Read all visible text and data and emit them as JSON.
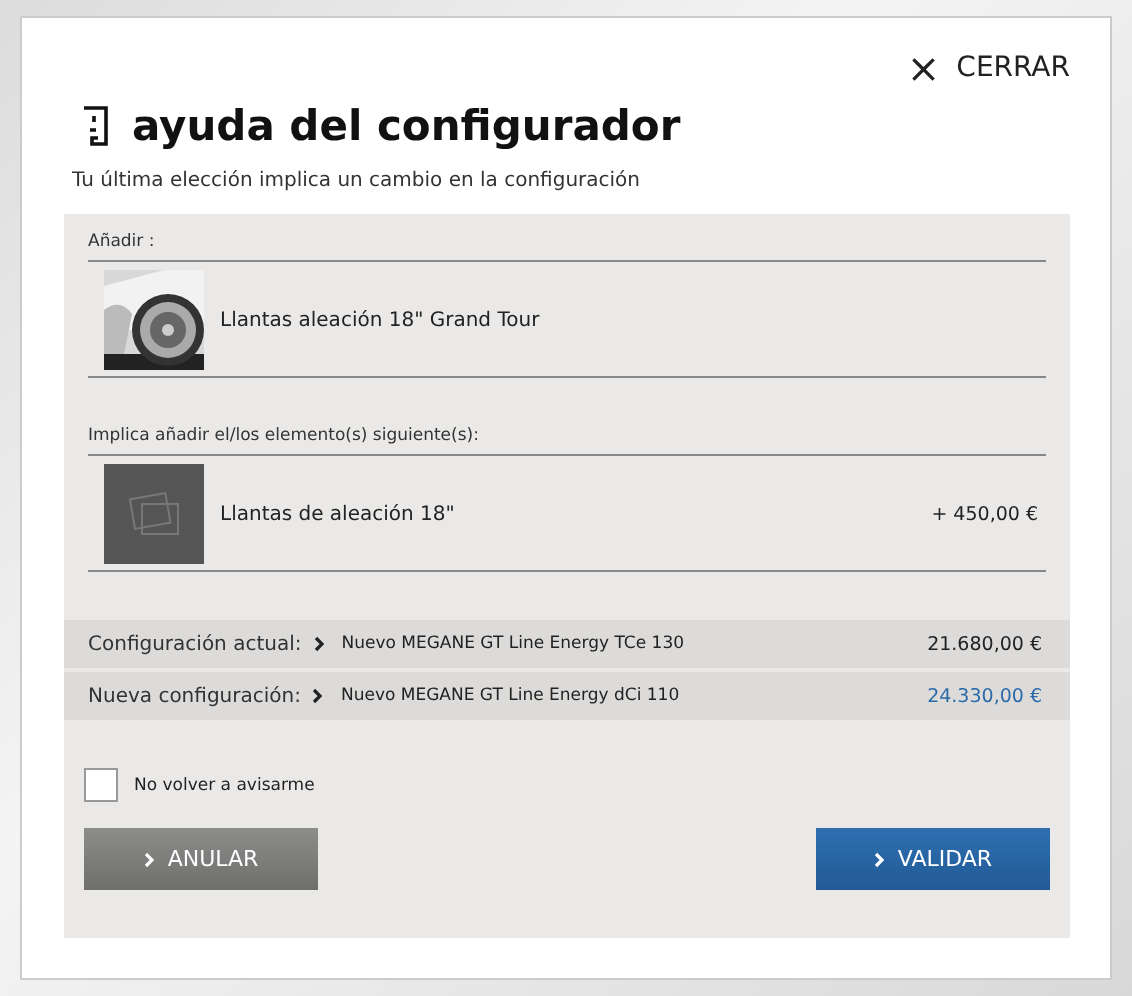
{
  "close": {
    "icon": "×",
    "label": "CERRAR"
  },
  "title": "ayuda del configurador",
  "subtitle": "Tu última elección implica un cambio en la configuración",
  "sections": [
    {
      "label": "Añadir :",
      "items": [
        {
          "name": "Llantas aleación 18\" Grand Tour"
        }
      ]
    },
    {
      "label": "Implica añadir el/los elemento(s) siguiente(s):",
      "items": [
        {
          "kind": "placeholder",
          "name": "Llantas de aleación 18\"",
          "price": "+ 450,00 €"
        }
      ]
    }
  ],
  "configurations": [
    {
      "label": "Configuración actual:",
      "model": "Nuevo MEGANE GT Line Energy TCe 130",
      "price": "21.680,00 €",
      "highlight": false
    },
    {
      "label": "Nueva configuración:",
      "model": "Nuevo MEGANE GT Line Energy dCi 110",
      "price": "24.330,00 €",
      "highlight": true
    }
  ],
  "dont_warn": {
    "label": "No volver a avisarme",
    "checked": false
  },
  "buttons": [
    {
      "kind": "secondary",
      "label": "ANULAR"
    },
    {
      "kind": "primary",
      "label": "VALIDAR"
    }
  ]
}
